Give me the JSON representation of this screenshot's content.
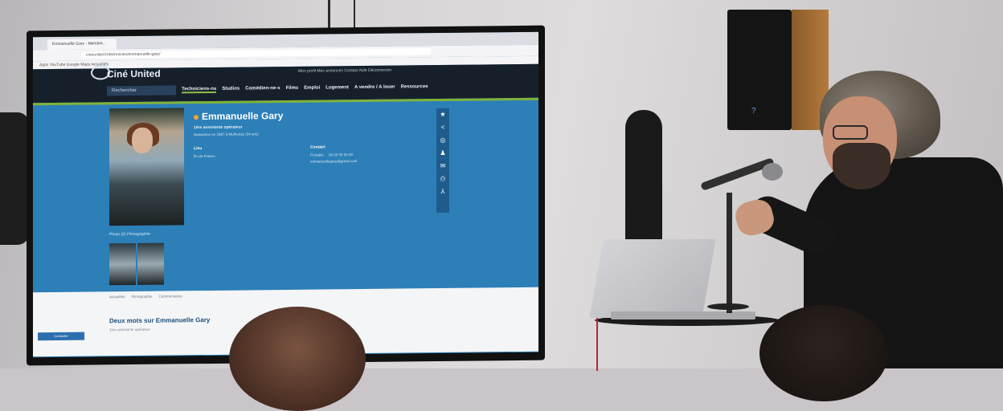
{
  "browser": {
    "tab_title": "Emmanuelle Gary - Membre...",
    "url": "cineunited.fr/technicien/emmanuelle-gary/",
    "bookmarks": "Apps  YouTube  Google  Maps  Actualités"
  },
  "site": {
    "logo": "Ciné United",
    "search_placeholder": "Rechercher",
    "top_links": "Mon profil   Mes annonces   Contact   Aide   Déconnexion",
    "nav": [
      "Techniciens-ns",
      "Studios",
      "Comédien-ne-s",
      "Films",
      "Emploi",
      "Logement",
      "A vendre / A louer",
      "Ressources"
    ]
  },
  "profile": {
    "name": "Emmanuelle Gary",
    "role": "1ère assistante opérateur",
    "birth": "Naissance en 1987 à Mulhouse (34 ans)",
    "lieu_label": "Lieu",
    "lieu_value": "Île-de-France",
    "contact_label": "Contact",
    "phone_label": "Portable",
    "phone_value": "06 00 00 00 00",
    "email_value": "emmanuellegary@gmail.com"
  },
  "sidebar_icons": [
    "star-icon",
    "share-icon",
    "globe-icon",
    "user-icon",
    "mail-icon",
    "print-icon",
    "pdf-icon"
  ],
  "photo_tabs": "Photo (2)    Filmographie",
  "lower": {
    "tabs": [
      "Actualités",
      "Filmographie",
      "Commentaires"
    ],
    "heading": "Deux mots sur Emmanuelle Gary",
    "sub": "1ère assistante opérateur",
    "button": "Contacter"
  }
}
